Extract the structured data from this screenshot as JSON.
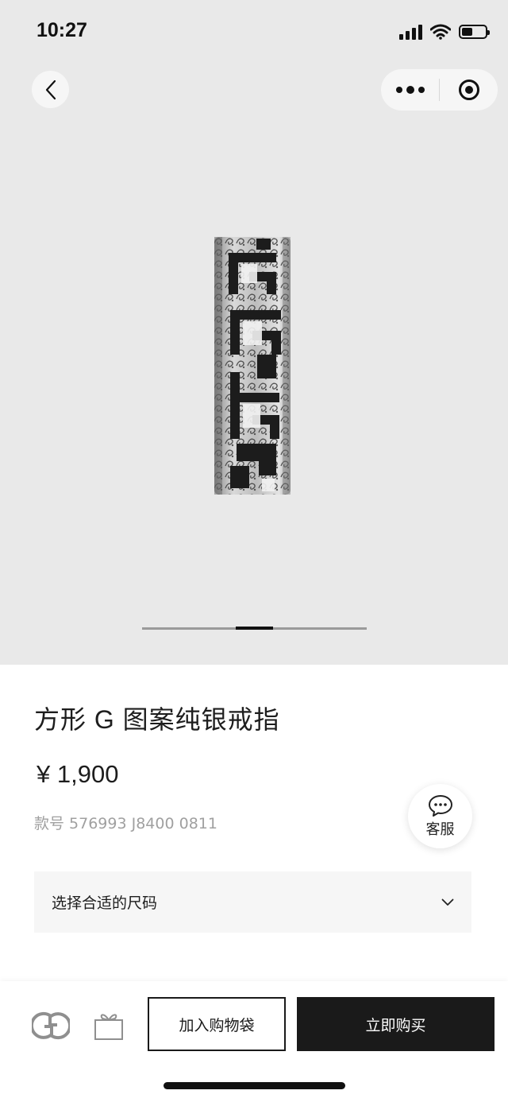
{
  "status_bar": {
    "time": "10:27"
  },
  "nav": {
    "back_icon": "chevron-left-icon",
    "more_icon": "more-dots-icon",
    "close_icon": "target-close-icon"
  },
  "gallery": {
    "slide_count": 3,
    "active_slide": 2
  },
  "product": {
    "title": "方形 G 图案纯银戒指",
    "price": "¥ 1,900",
    "sku": "款号 576993 J8400 0811"
  },
  "service": {
    "label": "客服",
    "icon": "chat-bubble-icon"
  },
  "size_selector": {
    "label": "选择合适的尺码",
    "icon": "chevron-down-icon"
  },
  "bottom_bar": {
    "logo_icon": "gg-logo-icon",
    "gift_icon": "gift-bag-icon",
    "add_to_cart": "加入购物袋",
    "buy_now": "立即购买"
  },
  "colors": {
    "primary": "#1a1a1a",
    "background": "#e9e9e9",
    "muted_text": "#a0a0a0"
  }
}
